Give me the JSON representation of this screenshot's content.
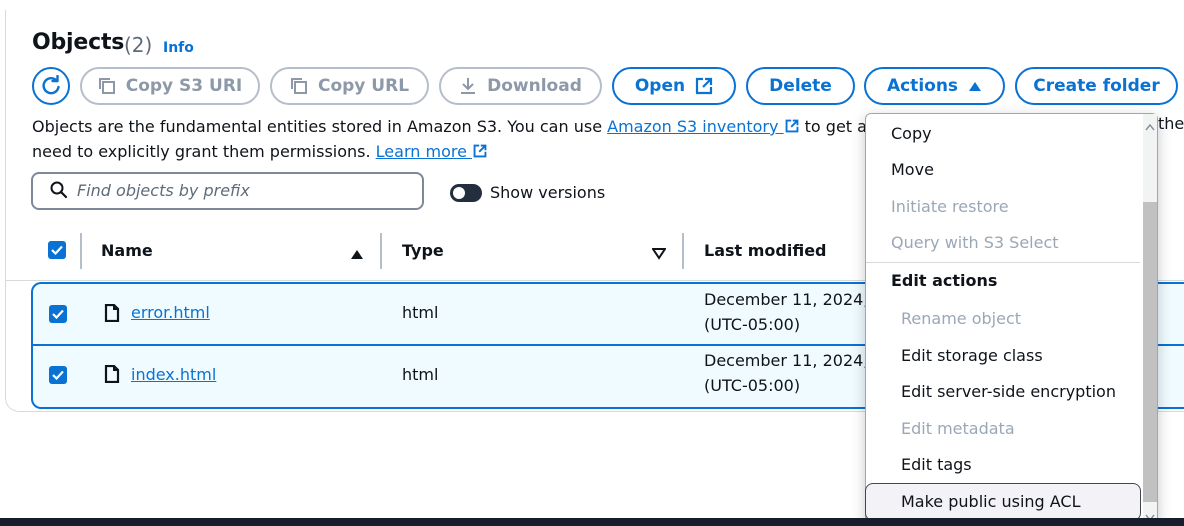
{
  "header": {
    "title": "Objects",
    "count": "(2)",
    "info": "Info"
  },
  "toolbar": {
    "copy_s3_uri": "Copy S3 URI",
    "copy_url": "Copy URL",
    "download": "Download",
    "open": "Open",
    "delete": "Delete",
    "actions": "Actions",
    "create_folder": "Create folder"
  },
  "description": {
    "text1": "Objects are the fundamental entities stored in Amazon S3. You can use ",
    "link1": "Amazon S3 inventory",
    "text2": " to get a l",
    "text3": "the",
    "line2": "need to explicitly grant them permissions. ",
    "link2": "Learn more"
  },
  "search": {
    "placeholder": "Find objects by prefix"
  },
  "show_versions": "Show versions",
  "table": {
    "headers": {
      "name": "Name",
      "type": "Type",
      "last_modified": "Last modified"
    },
    "rows": [
      {
        "name": "error.html",
        "type": "html",
        "date_line1": "December 11, 2024,",
        "date_line2": "(UTC-05:00)"
      },
      {
        "name": "index.html",
        "type": "html",
        "date_line1": "December 11, 2024,",
        "date_line2": "(UTC-05:00)"
      }
    ]
  },
  "actions_menu": {
    "items": [
      {
        "label": "Copy",
        "disabled": false
      },
      {
        "label": "Move",
        "disabled": false
      },
      {
        "label": "Initiate restore",
        "disabled": true
      },
      {
        "label": "Query with S3 Select",
        "disabled": true
      }
    ],
    "group_label": "Edit actions",
    "edit_items": [
      {
        "label": "Rename object",
        "disabled": true
      },
      {
        "label": "Edit storage class",
        "disabled": false
      },
      {
        "label": "Edit server-side encryption",
        "disabled": false
      },
      {
        "label": "Edit metadata",
        "disabled": true
      },
      {
        "label": "Edit tags",
        "disabled": false
      },
      {
        "label": "Make public using ACL",
        "disabled": false
      }
    ]
  },
  "colors": {
    "accent": "#0972d3",
    "disabled": "#8d99a8",
    "row_selected_bg": "#f0fbff"
  }
}
